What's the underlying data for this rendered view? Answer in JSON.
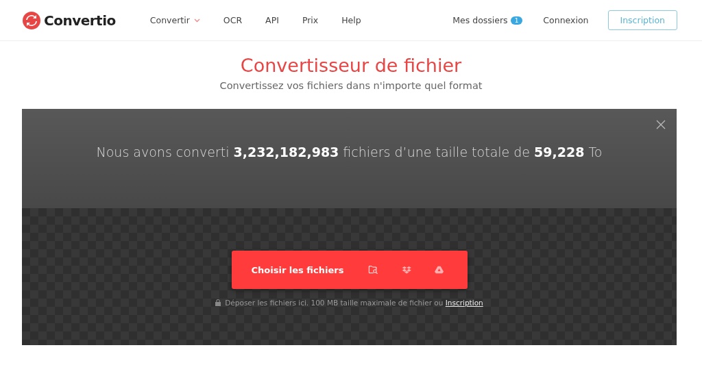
{
  "header": {
    "logo": "Convertio",
    "nav": [
      {
        "label": "Convertir",
        "dropdown": true
      },
      {
        "label": "OCR",
        "dropdown": false
      },
      {
        "label": "API",
        "dropdown": false
      },
      {
        "label": "Prix",
        "dropdown": false
      },
      {
        "label": "Help",
        "dropdown": false
      }
    ],
    "folders": {
      "label": "Mes dossiers",
      "count": "1"
    },
    "login": "Connexion",
    "signup": "Inscription"
  },
  "hero": {
    "title": "Convertisseur de fichier",
    "subtitle": "Convertissez vos fichiers dans n'importe quel format"
  },
  "converter": {
    "stats": "Nous avons converti **3,232,182,983** fichiers d’une taille totale de **59,228** To",
    "button": "Choisir les fichiers",
    "note": "Déposer les fichiers ici. 100 MB taille maximale de fichier ou",
    "note_link": "Inscription"
  }
}
